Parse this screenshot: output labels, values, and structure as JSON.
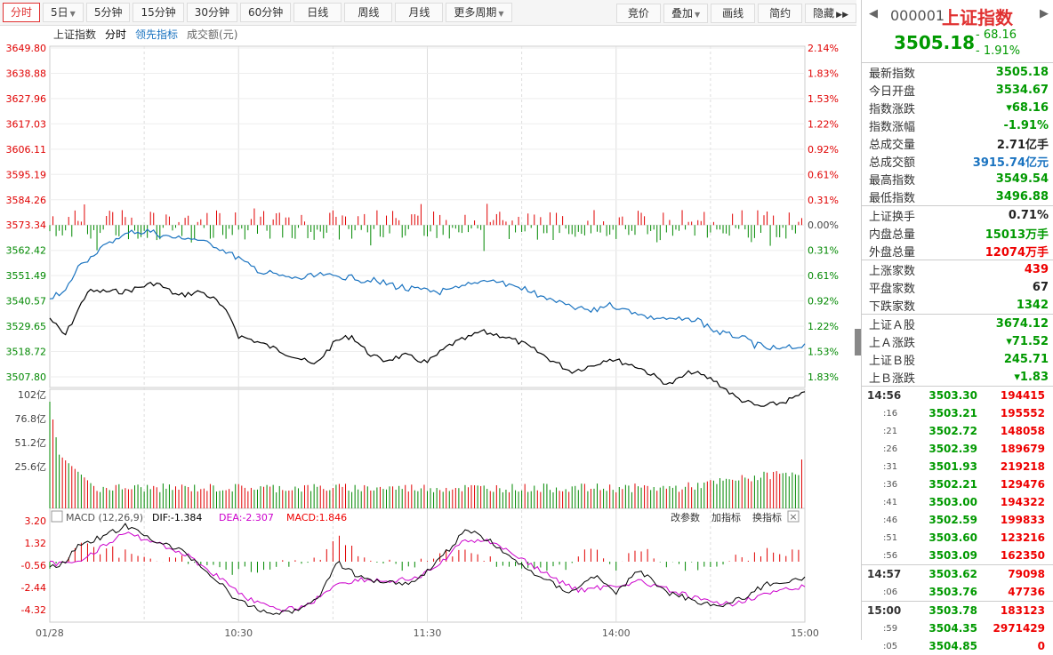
{
  "toolbar": {
    "periods": [
      "分时",
      "5日",
      "5分钟",
      "15分钟",
      "30分钟",
      "60分钟",
      "日线",
      "周线",
      "月线",
      "更多周期"
    ],
    "right": [
      "竞价",
      "叠加",
      "画线",
      "简约",
      "隐藏"
    ]
  },
  "legend": {
    "name": "上证指数",
    "mode": "分时",
    "lead": "领先指标",
    "amount": "成交额(元)"
  },
  "price_axis": {
    "left": [
      "3649.80",
      "3638.88",
      "3627.96",
      "3617.03",
      "3606.11",
      "3595.19",
      "3584.26",
      "3573.34",
      "3562.42",
      "3551.49",
      "3540.57",
      "3529.65",
      "3518.72",
      "3507.80"
    ],
    "right": [
      "2.14%",
      "1.83%",
      "1.53%",
      "1.22%",
      "0.92%",
      "0.61%",
      "0.31%",
      "0.00%",
      "0.31%",
      "0.61%",
      "0.92%",
      "1.22%",
      "1.53%",
      "1.83%"
    ]
  },
  "volume_axis": [
    "102亿",
    "76.8亿",
    "51.2亿",
    "25.6亿"
  ],
  "macd": {
    "label": "MACD (12,26,9)",
    "dif": "DIF:-1.384",
    "dea": "DEA:-2.307",
    "macd": "MACD:1.846",
    "axis": [
      "3.20",
      "1.32",
      "-0.56",
      "-2.44",
      "-4.32"
    ],
    "actions": [
      "改参数",
      "加指标",
      "换指标"
    ]
  },
  "time_axis": [
    "01/28",
    "10:30",
    "11:30",
    "14:00",
    "15:00"
  ],
  "colors": {
    "up": "#e00000",
    "down": "#008800",
    "avg": "#1a73c0",
    "price": "#000000",
    "dea": "#cc00cc"
  },
  "panel": {
    "code": "000001",
    "name": "上证指数",
    "last": "3505.18",
    "change": "- 68.16",
    "pct": "- 1.91%",
    "stats": [
      {
        "k": "最新指数",
        "v": "3505.18",
        "c": "green"
      },
      {
        "k": "今日开盘",
        "v": "3534.67",
        "c": "green"
      },
      {
        "k": "指数涨跌",
        "v": "▾68.16",
        "c": "green"
      },
      {
        "k": "指数涨幅",
        "v": "-1.91%",
        "c": "green"
      },
      {
        "k": "总成交量",
        "v": "2.71亿手",
        "c": "dark"
      },
      {
        "k": "总成交额",
        "v": "3915.74亿元",
        "c": "blue"
      },
      {
        "k": "最高指数",
        "v": "3549.54",
        "c": "green"
      },
      {
        "k": "最低指数",
        "v": "3496.88",
        "c": "green"
      }
    ],
    "stats2": [
      {
        "k": "上证换手",
        "v": "0.71%",
        "c": "dark"
      },
      {
        "k": "内盘总量",
        "v": "15013万手",
        "c": "green"
      },
      {
        "k": "外盘总量",
        "v": "12074万手",
        "c": "red"
      }
    ],
    "stats3": [
      {
        "k": "上涨家数",
        "v": "439",
        "c": "red"
      },
      {
        "k": "平盘家数",
        "v": "67",
        "c": "dark"
      },
      {
        "k": "下跌家数",
        "v": "1342",
        "c": "green"
      }
    ],
    "stats4": [
      {
        "k": "上证Ａ股",
        "v": "3674.12",
        "c": "green"
      },
      {
        "k": "上Ａ涨跌",
        "v": "▾71.52",
        "c": "green"
      },
      {
        "k": "上证Ｂ股",
        "v": "245.71",
        "c": "green"
      },
      {
        "k": "上Ｂ涨跌",
        "v": "▾1.83",
        "c": "green"
      }
    ],
    "ticks": [
      {
        "t": "14:56",
        "p": "3503.30",
        "v": "194415",
        "big": true
      },
      {
        "t": ":16",
        "p": "3503.21",
        "v": "195552"
      },
      {
        "t": ":21",
        "p": "3502.72",
        "v": "148058"
      },
      {
        "t": ":26",
        "p": "3502.39",
        "v": "189679"
      },
      {
        "t": ":31",
        "p": "3501.93",
        "v": "219218"
      },
      {
        "t": ":36",
        "p": "3502.21",
        "v": "129476"
      },
      {
        "t": ":41",
        "p": "3503.00",
        "v": "194322"
      },
      {
        "t": ":46",
        "p": "3502.59",
        "v": "199833"
      },
      {
        "t": ":51",
        "p": "3503.60",
        "v": "123216"
      },
      {
        "t": ":56",
        "p": "3503.09",
        "v": "162350"
      },
      {
        "t": "14:57",
        "p": "3503.62",
        "v": "79098",
        "big": true
      },
      {
        "t": ":06",
        "p": "3503.76",
        "v": "47736"
      },
      {
        "t": "15:00",
        "p": "3503.78",
        "v": "183123",
        "big": true
      },
      {
        "t": ":59",
        "p": "3504.35",
        "v": "2971429"
      },
      {
        "t": ":05",
        "p": "3504.85",
        "v": "0"
      }
    ]
  }
}
